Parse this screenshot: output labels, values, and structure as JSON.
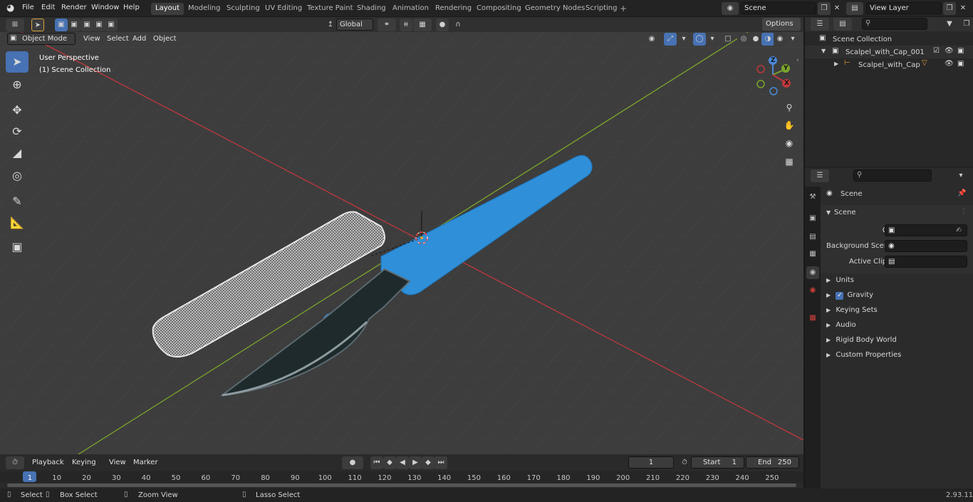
{
  "app": {
    "version": "2.93.11",
    "logo_icon": "blender-logo-icon"
  },
  "menu": [
    "File",
    "Edit",
    "Render",
    "Window",
    "Help"
  ],
  "workspaces": [
    "Layout",
    "Modeling",
    "Sculpting",
    "UV Editing",
    "Texture Paint",
    "Shading",
    "Animation",
    "Rendering",
    "Compositing",
    "Geometry Nodes",
    "Scripting"
  ],
  "active_workspace": "Layout",
  "scene_field": "Scene",
  "view_layer_field": "View Layer",
  "viewport": {
    "mode": "Object Mode",
    "header_menus": [
      "View",
      "Select",
      "Add",
      "Object"
    ],
    "transform_orientation": "Global",
    "options_label": "Options",
    "overlay_line1": "User Perspective",
    "overlay_line2": "(1) Scene Collection",
    "axis_labels": {
      "z": "Z",
      "y": "Y",
      "x": "X"
    }
  },
  "outliner": {
    "root": "Scene Collection",
    "items": [
      {
        "label": "Scalpel_with_Cap_001"
      },
      {
        "label": "Scalpel_with_Cap"
      }
    ]
  },
  "properties": {
    "context_title": "Scene",
    "section_title": "Scene",
    "fields": [
      {
        "label": "Camera"
      },
      {
        "label": "Background Scene"
      },
      {
        "label": "Active Clip"
      }
    ],
    "panels": [
      "Units",
      "Gravity",
      "Keying Sets",
      "Audio",
      "Rigid Body World",
      "Custom Properties"
    ]
  },
  "timeline": {
    "menus": [
      "Playback",
      "Keying",
      "View",
      "Marker"
    ],
    "current_frame": "1",
    "start_label": "Start",
    "start_value": "1",
    "end_label": "End",
    "end_value": "250",
    "ticks": [
      "1",
      "10",
      "20",
      "30",
      "40",
      "50",
      "60",
      "70",
      "80",
      "90",
      "100",
      "110",
      "120",
      "130",
      "140",
      "150",
      "160",
      "170",
      "180",
      "190",
      "200",
      "210",
      "220",
      "230",
      "240",
      "250"
    ]
  },
  "status": {
    "select": "Select",
    "box_select": "Box Select",
    "zoom_view": "Zoom View",
    "lasso_select": "Lasso Select"
  },
  "colors": {
    "accent": "#4772b3",
    "scalpel_handle": "#2f8fd8",
    "blade": "#1e2a2c",
    "x_axis": "#c0383c",
    "y_axis": "#7ba52b"
  }
}
